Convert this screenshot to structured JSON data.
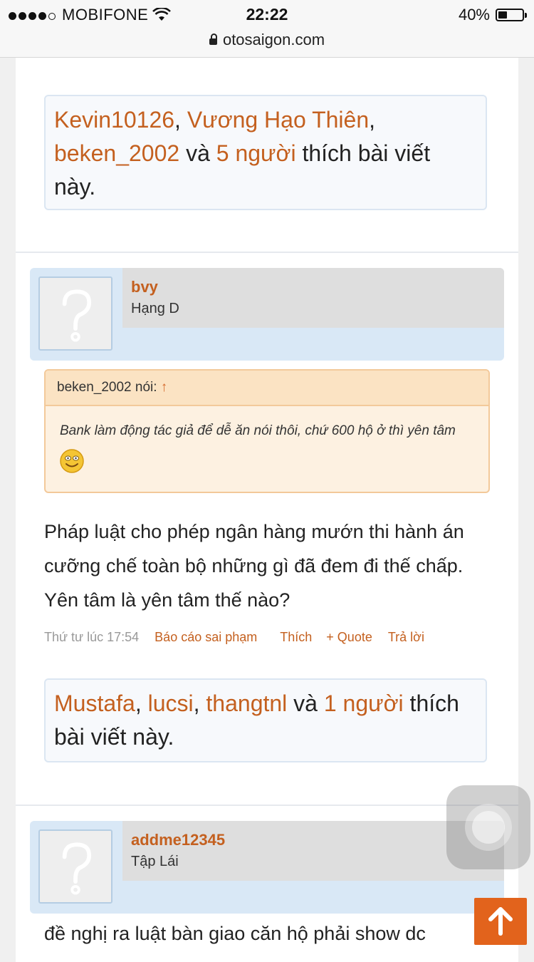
{
  "status_bar": {
    "carrier": "MOBIFONE",
    "time": "22:22",
    "battery": "40%",
    "battery_level": 0.4,
    "url": "otosaigon.com"
  },
  "post1": {
    "likes": {
      "users": [
        "Kevin10126",
        "Vương Hạo Thiên",
        "beken_2002"
      ],
      "conj": "và",
      "others": "5 người",
      "suffix": "thích bài viết này."
    }
  },
  "post2": {
    "username": "bvy",
    "rank": "Hạng D",
    "quote": {
      "author_line": "beken_2002 nói:",
      "arrow": "↑",
      "text": "Bank làm động tác giả để dễ ăn nói thôi, chứ 600 hộ ở thì yên tâm"
    },
    "body": "Pháp luật cho phép ngân hàng mướn thi hành án cưỡng chế toàn bộ những gì đã đem đi thế chấp. Yên tâm là yên tâm thế nào?",
    "meta": {
      "time": "Thứ tư lúc 17:54",
      "report": "Báo cáo sai phạm",
      "like": "Thích",
      "quote": "+ Quote",
      "reply": "Trả lời"
    },
    "likes": {
      "users": [
        "Mustafa",
        "lucsi",
        "thangtnl"
      ],
      "conj": "và",
      "others": "1 người",
      "suffix": "thích bài viết này."
    }
  },
  "post3": {
    "username": "addme12345",
    "rank": "Tập Lái",
    "body": "đề nghị ra luật bàn giao căn hộ phải show dc"
  },
  "icons": {
    "lock": "lock-icon",
    "wifi": "wifi-icon",
    "avatar": "default-avatar-icon",
    "smiley": "smiley-icon",
    "scroll_top": "arrow-up-icon",
    "assistive": "assistive-touch-icon"
  },
  "colors": {
    "link": "#c4601f",
    "scroll_top_bg": "#e2631c",
    "quote_bg": "#fdf1e1",
    "header_bg": "#d9e8f6"
  }
}
